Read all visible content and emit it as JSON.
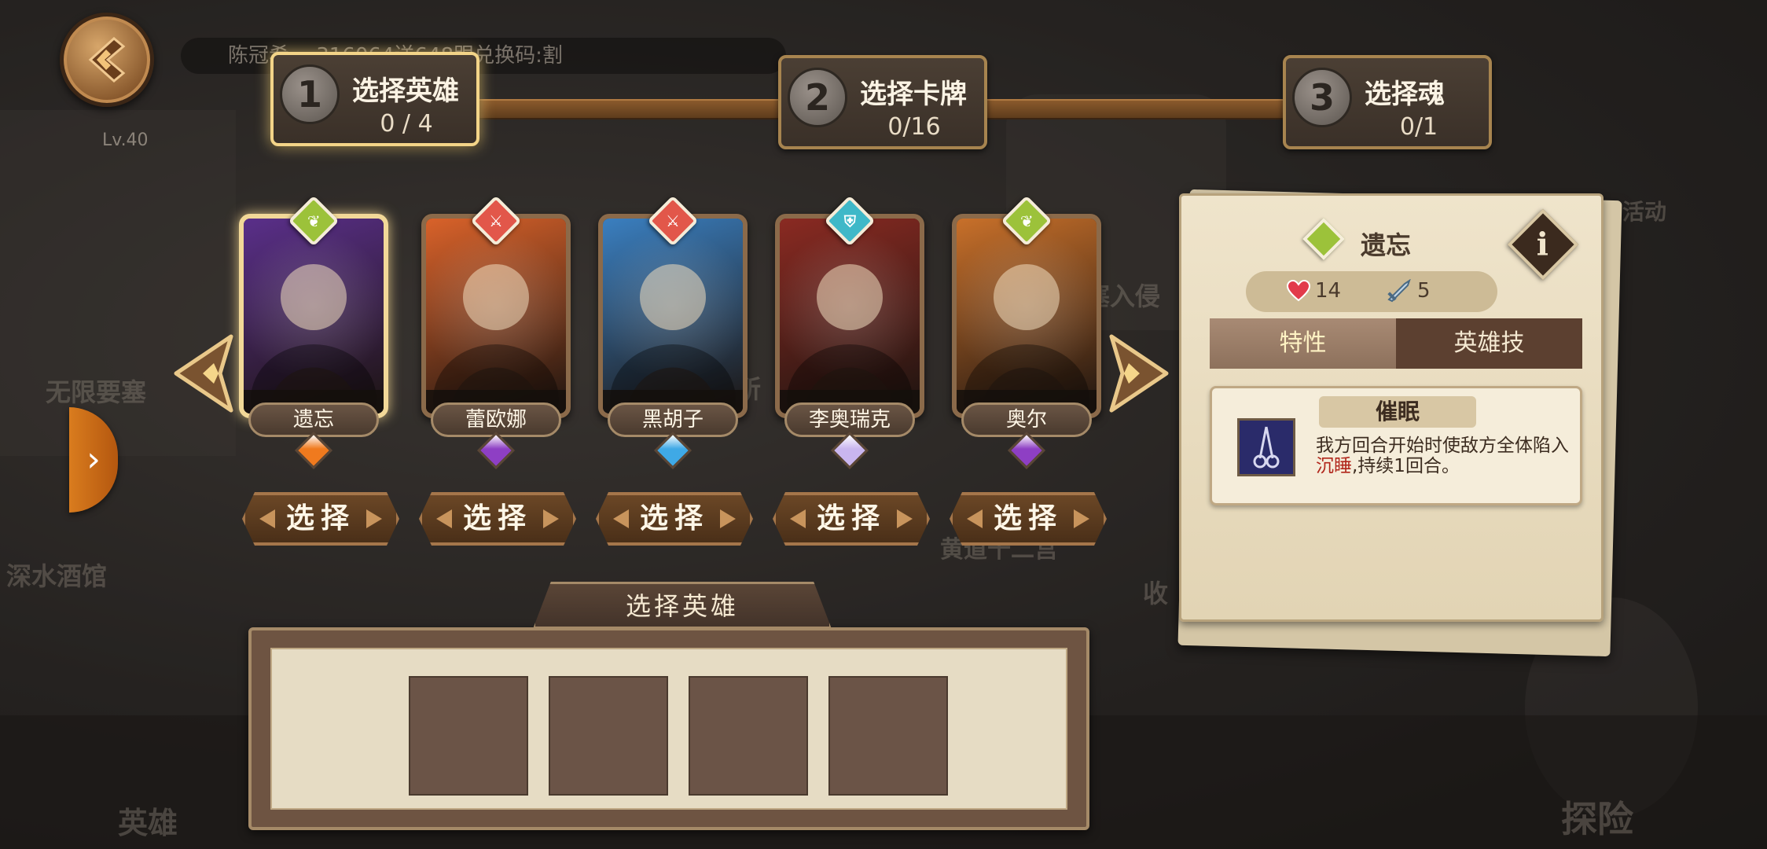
{
  "background": {
    "ticker": "陈冠希… 316064送648跟兑换码:割",
    "level": "Lv.40",
    "labels": [
      "无限要塞",
      "深水酒馆",
      "活动",
      "塞入侵",
      "黄道十二宫",
      "收",
      "所",
      "英雄",
      "探险"
    ]
  },
  "steps": [
    {
      "num": "1",
      "title": "选择英雄",
      "count": "0 / 4",
      "active": true
    },
    {
      "num": "2",
      "title": "选择卡牌",
      "count": "0/16",
      "active": false
    },
    {
      "num": "3",
      "title": "选择魂",
      "count": "0/1",
      "active": false
    }
  ],
  "heroes": [
    {
      "name": "遗忘",
      "class_color": "#9cc23a",
      "class_icon": "leaf-icon",
      "rarity_color": "#f07a1e",
      "bg": "#5a2f8a",
      "selected": true
    },
    {
      "name": "蕾欧娜",
      "class_color": "#e2574a",
      "class_icon": "sword-icon",
      "rarity_color": "#8e3fc4",
      "bg": "#d9622a",
      "selected": false
    },
    {
      "name": "黑胡子",
      "class_color": "#e2574a",
      "class_icon": "sword-icon",
      "rarity_color": "#3fa9e6",
      "bg": "#3a7fc0",
      "selected": false
    },
    {
      "name": "李奥瑞克",
      "class_color": "#3fb8c8",
      "class_icon": "shield-icon",
      "rarity_color": "#c9b6ef",
      "bg": "#8a2a22",
      "selected": false
    },
    {
      "name": "奥尔",
      "class_color": "#9cc23a",
      "class_icon": "leaf-icon",
      "rarity_color": "#8e3fc4",
      "bg": "#c8702a",
      "selected": false
    }
  ],
  "select_label": "选择",
  "detail": {
    "name": "遗忘",
    "hp": "14",
    "attack": "5",
    "tabs": [
      {
        "label": "特性",
        "active": true
      },
      {
        "label": "英雄技",
        "active": false
      }
    ],
    "trait_title": "催眠",
    "trait_desc_1": "我方回合开始时使敌方全体陷入",
    "trait_desc_hl": "沉睡",
    "trait_desc_2": ",持续1回合。",
    "info_label": "i"
  },
  "slots": {
    "title": "选择英雄",
    "count": 4
  },
  "side_tab_glyph": "›"
}
